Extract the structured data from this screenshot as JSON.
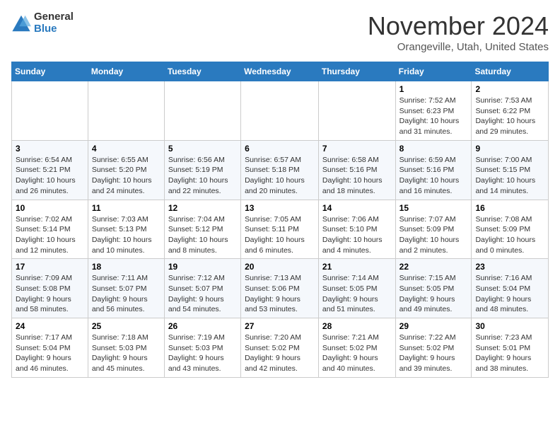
{
  "header": {
    "logo_general": "General",
    "logo_blue": "Blue",
    "month_title": "November 2024",
    "location": "Orangeville, Utah, United States"
  },
  "calendar": {
    "days_of_week": [
      "Sunday",
      "Monday",
      "Tuesday",
      "Wednesday",
      "Thursday",
      "Friday",
      "Saturday"
    ],
    "weeks": [
      [
        {
          "day": "",
          "info": ""
        },
        {
          "day": "",
          "info": ""
        },
        {
          "day": "",
          "info": ""
        },
        {
          "day": "",
          "info": ""
        },
        {
          "day": "",
          "info": ""
        },
        {
          "day": "1",
          "info": "Sunrise: 7:52 AM\nSunset: 6:23 PM\nDaylight: 10 hours and 31 minutes."
        },
        {
          "day": "2",
          "info": "Sunrise: 7:53 AM\nSunset: 6:22 PM\nDaylight: 10 hours and 29 minutes."
        }
      ],
      [
        {
          "day": "3",
          "info": "Sunrise: 6:54 AM\nSunset: 5:21 PM\nDaylight: 10 hours and 26 minutes."
        },
        {
          "day": "4",
          "info": "Sunrise: 6:55 AM\nSunset: 5:20 PM\nDaylight: 10 hours and 24 minutes."
        },
        {
          "day": "5",
          "info": "Sunrise: 6:56 AM\nSunset: 5:19 PM\nDaylight: 10 hours and 22 minutes."
        },
        {
          "day": "6",
          "info": "Sunrise: 6:57 AM\nSunset: 5:18 PM\nDaylight: 10 hours and 20 minutes."
        },
        {
          "day": "7",
          "info": "Sunrise: 6:58 AM\nSunset: 5:16 PM\nDaylight: 10 hours and 18 minutes."
        },
        {
          "day": "8",
          "info": "Sunrise: 6:59 AM\nSunset: 5:16 PM\nDaylight: 10 hours and 16 minutes."
        },
        {
          "day": "9",
          "info": "Sunrise: 7:00 AM\nSunset: 5:15 PM\nDaylight: 10 hours and 14 minutes."
        }
      ],
      [
        {
          "day": "10",
          "info": "Sunrise: 7:02 AM\nSunset: 5:14 PM\nDaylight: 10 hours and 12 minutes."
        },
        {
          "day": "11",
          "info": "Sunrise: 7:03 AM\nSunset: 5:13 PM\nDaylight: 10 hours and 10 minutes."
        },
        {
          "day": "12",
          "info": "Sunrise: 7:04 AM\nSunset: 5:12 PM\nDaylight: 10 hours and 8 minutes."
        },
        {
          "day": "13",
          "info": "Sunrise: 7:05 AM\nSunset: 5:11 PM\nDaylight: 10 hours and 6 minutes."
        },
        {
          "day": "14",
          "info": "Sunrise: 7:06 AM\nSunset: 5:10 PM\nDaylight: 10 hours and 4 minutes."
        },
        {
          "day": "15",
          "info": "Sunrise: 7:07 AM\nSunset: 5:09 PM\nDaylight: 10 hours and 2 minutes."
        },
        {
          "day": "16",
          "info": "Sunrise: 7:08 AM\nSunset: 5:09 PM\nDaylight: 10 hours and 0 minutes."
        }
      ],
      [
        {
          "day": "17",
          "info": "Sunrise: 7:09 AM\nSunset: 5:08 PM\nDaylight: 9 hours and 58 minutes."
        },
        {
          "day": "18",
          "info": "Sunrise: 7:11 AM\nSunset: 5:07 PM\nDaylight: 9 hours and 56 minutes."
        },
        {
          "day": "19",
          "info": "Sunrise: 7:12 AM\nSunset: 5:07 PM\nDaylight: 9 hours and 54 minutes."
        },
        {
          "day": "20",
          "info": "Sunrise: 7:13 AM\nSunset: 5:06 PM\nDaylight: 9 hours and 53 minutes."
        },
        {
          "day": "21",
          "info": "Sunrise: 7:14 AM\nSunset: 5:05 PM\nDaylight: 9 hours and 51 minutes."
        },
        {
          "day": "22",
          "info": "Sunrise: 7:15 AM\nSunset: 5:05 PM\nDaylight: 9 hours and 49 minutes."
        },
        {
          "day": "23",
          "info": "Sunrise: 7:16 AM\nSunset: 5:04 PM\nDaylight: 9 hours and 48 minutes."
        }
      ],
      [
        {
          "day": "24",
          "info": "Sunrise: 7:17 AM\nSunset: 5:04 PM\nDaylight: 9 hours and 46 minutes."
        },
        {
          "day": "25",
          "info": "Sunrise: 7:18 AM\nSunset: 5:03 PM\nDaylight: 9 hours and 45 minutes."
        },
        {
          "day": "26",
          "info": "Sunrise: 7:19 AM\nSunset: 5:03 PM\nDaylight: 9 hours and 43 minutes."
        },
        {
          "day": "27",
          "info": "Sunrise: 7:20 AM\nSunset: 5:02 PM\nDaylight: 9 hours and 42 minutes."
        },
        {
          "day": "28",
          "info": "Sunrise: 7:21 AM\nSunset: 5:02 PM\nDaylight: 9 hours and 40 minutes."
        },
        {
          "day": "29",
          "info": "Sunrise: 7:22 AM\nSunset: 5:02 PM\nDaylight: 9 hours and 39 minutes."
        },
        {
          "day": "30",
          "info": "Sunrise: 7:23 AM\nSunset: 5:01 PM\nDaylight: 9 hours and 38 minutes."
        }
      ]
    ]
  }
}
